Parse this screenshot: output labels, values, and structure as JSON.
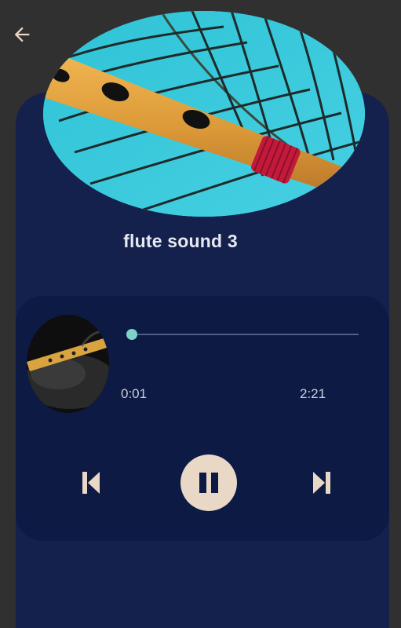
{
  "header": {
    "back_icon": "arrow-left-icon"
  },
  "now_playing": {
    "title": "flute sound 3",
    "cover_image": "flute-on-peacock-feather",
    "thumbnail_image": "flute-on-dark-cloth"
  },
  "player": {
    "current_time": "0:01",
    "total_time": "2:21",
    "progress": 0.007,
    "controls": {
      "previous_icon": "skip-previous-icon",
      "pause_icon": "pause-icon",
      "next_icon": "skip-next-icon"
    }
  },
  "colors": {
    "background": "#303030",
    "card": "#13214c",
    "player_panel": "#0c1a44",
    "accent": "#ead8c6",
    "progress_knob": "#7dd3c8"
  }
}
